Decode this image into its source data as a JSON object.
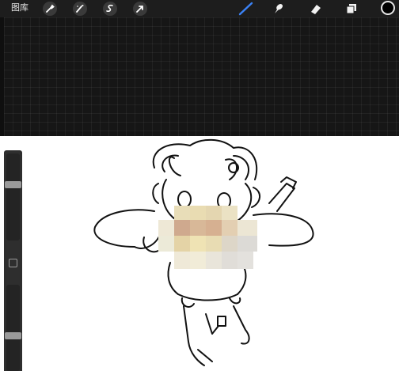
{
  "toolbar": {
    "gallery_label": "图库",
    "tools_left": [
      "wrench-icon",
      "magic-wand-icon",
      "selection-icon",
      "transform-icon"
    ],
    "tools_right": [
      "brush-icon",
      "smudge-icon",
      "eraser-icon",
      "layers-icon"
    ],
    "active_tool": "brush-icon",
    "current_color": "#000000",
    "accent_color": "#3b82f6"
  },
  "sidebar": {
    "brush_size_level": 0.65,
    "opacity_level": 0.4
  },
  "colors": {
    "canvas_dark": "#161616",
    "toolbar_bg": "#1d1d1d",
    "sidebar_bg": "#2e2e2e",
    "canvas_white": "#ffffff"
  }
}
